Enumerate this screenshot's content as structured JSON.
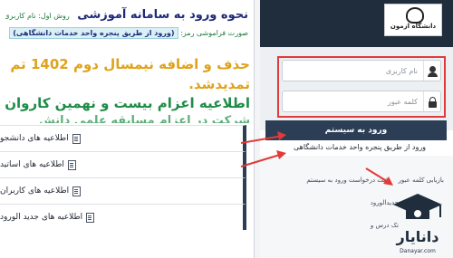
{
  "left": {
    "title": "نحوه ورود به سامانه آموزشی",
    "title_hint": "روش اول: نام کاربری (شم",
    "subtitle_label": "صورت فراموشی رمز:",
    "subtitle_box": "(ورود از طریق پنجره واحد خدمات دانشگاهی)",
    "news_1": "حذف و اضافه نیمسال دوم 1402 تم تمدیدشد.",
    "news_2": "اطلاعیه اعزام بیست و نهمین کاروان",
    "news_3": "شرکت در اعزام مسابقه علمی دانش",
    "menu": [
      {
        "label": "اطلاعیه های دانشجو"
      },
      {
        "label": "اطلاعیه های اساتید"
      },
      {
        "label": "اطلاعیه های کاربران"
      },
      {
        "label": "اطلاعیه های جدید الورود"
      }
    ]
  },
  "right": {
    "logo_text": "دانشگاه ازمون",
    "username_placeholder": "نام کاربری",
    "password_placeholder": "کلمه عبور",
    "login_button": "ورود به سیستم",
    "portal_link": "ورود از طریق پنجره واحد خدمات دانشگاهی",
    "lower_row1_a": "بازیابی کلمه عبور",
    "lower_row1_b": "ثبت درخواست ورود به سیستم",
    "lower_row2": "جدیدالورود",
    "lower_row3": "تک درس و"
  },
  "watermark": {
    "brand": "دانایار",
    "site": "Danayar.com"
  },
  "colors": {
    "arrow": "#e23a3a",
    "dark_navy": "#1f2d3d",
    "button": "#2b3e55",
    "news_yellow": "#e0a21a",
    "news_green": "#1e8d47"
  }
}
